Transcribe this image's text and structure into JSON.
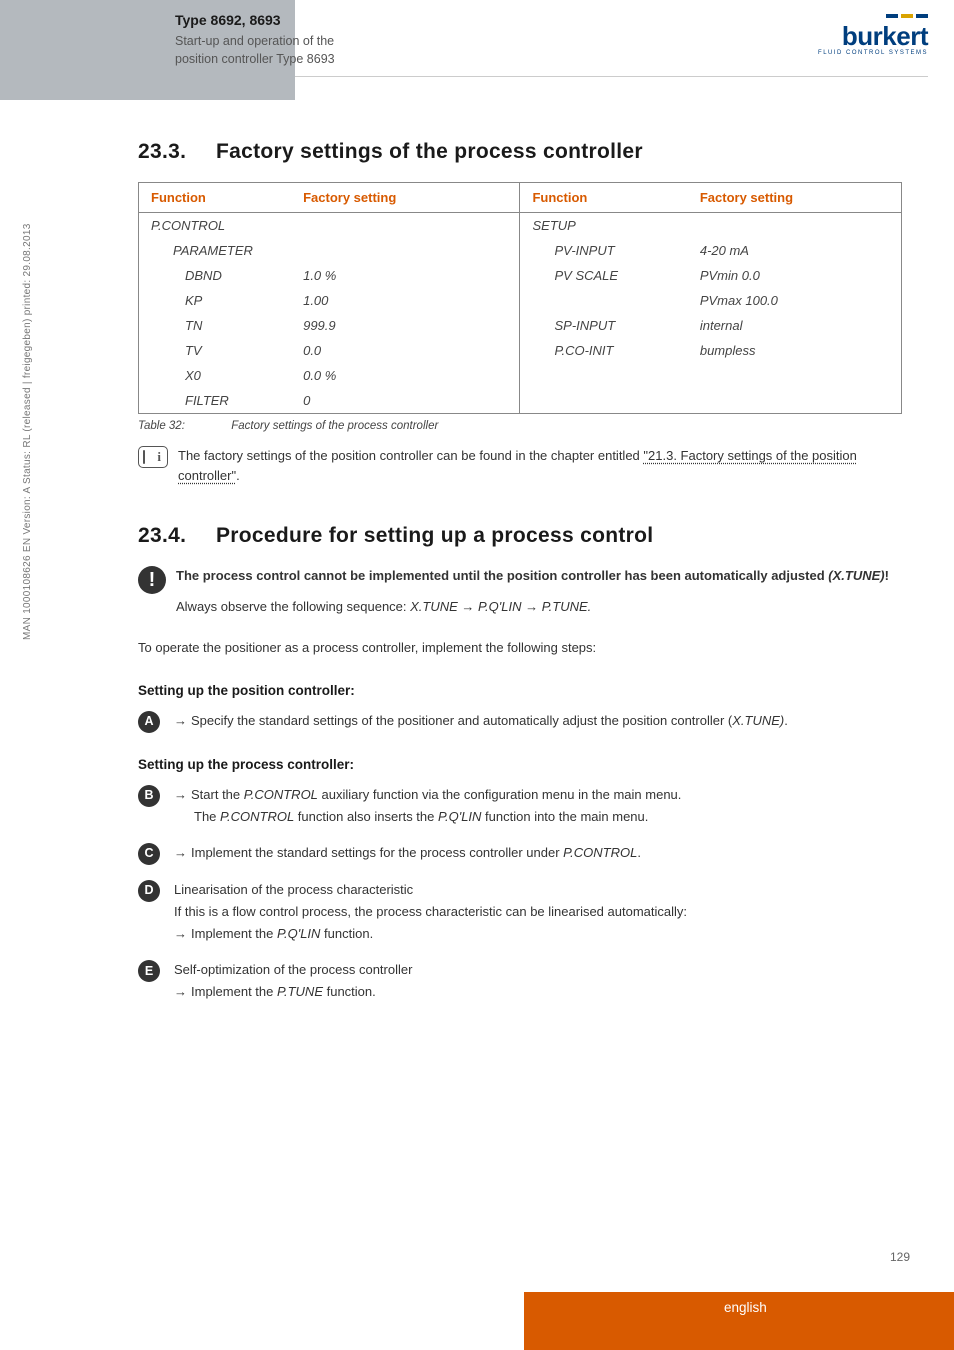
{
  "header": {
    "type_label": "Type 8692, 8693",
    "subtitle_line1": "Start-up and operation of the",
    "subtitle_line2": "position controller Type 8693",
    "logo_text": "burkert",
    "logo_sub": "FLUID CONTROL SYSTEMS"
  },
  "section1": {
    "number": "23.3.",
    "title": "Factory settings of the process controller"
  },
  "table": {
    "headers": {
      "func": "Function",
      "setting": "Factory setting",
      "func2": "Function",
      "setting2": "Factory setting"
    },
    "rows": [
      {
        "a": "P.CONTROL",
        "b": "",
        "c": "SETUP",
        "d": ""
      },
      {
        "a_ind": 1,
        "a": "PARAMETER",
        "b": "",
        "c_ind": 1,
        "c": "PV-INPUT",
        "d": "4-20 mA"
      },
      {
        "a_ind": 2,
        "a": "DBND",
        "b": "1.0 %",
        "c_ind": 1,
        "c": "PV SCALE",
        "d": "PVmin   0.0"
      },
      {
        "a_ind": 2,
        "a": "KP",
        "b": "1.00",
        "c_ind": 1,
        "c": "",
        "d": "PVmax   100.0"
      },
      {
        "a_ind": 2,
        "a": "TN",
        "b": "999.9",
        "c_ind": 1,
        "c": "SP-INPUT",
        "d": "internal"
      },
      {
        "a_ind": 2,
        "a": "TV",
        "b": "0.0",
        "c_ind": 1,
        "c": "P.CO-INIT",
        "d": "bumpless"
      },
      {
        "a_ind": 2,
        "a": "X0",
        "b": "0.0 %",
        "c": "",
        "d": ""
      },
      {
        "a_ind": 2,
        "a": "FILTER",
        "b": "0",
        "c": "",
        "d": ""
      }
    ],
    "caption_num": "Table 32:",
    "caption_text": "Factory settings of the process controller"
  },
  "info_note": {
    "pre": "The factory settings of the position controller can be found in the chapter entitled ",
    "link": "\"21.3. Factory settings of the position controller\"",
    "post": "."
  },
  "section2": {
    "number": "23.4.",
    "title": "Procedure for setting up a process control"
  },
  "warning": {
    "line1a": "The process control cannot be implemented until the position controller has been automatically adjusted ",
    "line1b": "(X.TUNE)",
    "line1c": "!",
    "line2a": "Always observe the following sequence: ",
    "line2b": "X.TUNE  →  P.Q'LIN  →  P.TUNE."
  },
  "intro": "To operate the positioner as a process controller, implement the following steps:",
  "subhead1": "Setting up the position controller:",
  "stepA": {
    "letter": "A",
    "text_pre": "Specify the standard settings of the positioner and automatically adjust the position controller (",
    "text_it": "X.TUNE)",
    "text_post": "."
  },
  "subhead2": "Setting up the process controller:",
  "stepB": {
    "letter": "B",
    "l1_pre": "Start the ",
    "l1_it1": "P.CONTROL",
    "l1_mid": " auxiliary function via the configuration menu in the main menu.",
    "l2_pre": "The ",
    "l2_it1": "P.CONTROL",
    "l2_mid": " function also inserts the ",
    "l2_it2": "P.Q'LIN",
    "l2_post": " function into the main menu."
  },
  "stepC": {
    "letter": "C",
    "text_pre": "Implement the standard settings for the process controller under ",
    "text_it": "P.CONTROL",
    "text_post": "."
  },
  "stepD": {
    "letter": "D",
    "title": "Linearisation of the process characteristic",
    "l1": "If this is a flow control process, the process characteristic can be linearised automatically:",
    "l2_pre": "Implement the ",
    "l2_it": "P.Q'LIN",
    "l2_post": " function."
  },
  "stepE": {
    "letter": "E",
    "title": "Self-optimization of the process controller",
    "l1_pre": "Implement the ",
    "l1_it": "P.TUNE",
    "l1_post": " function."
  },
  "sidetext": "MAN 1000108626 EN Version: A Status: RL (released | freigegeben) printed: 29.08.2013",
  "page_number": "129",
  "footer_lang": "english"
}
